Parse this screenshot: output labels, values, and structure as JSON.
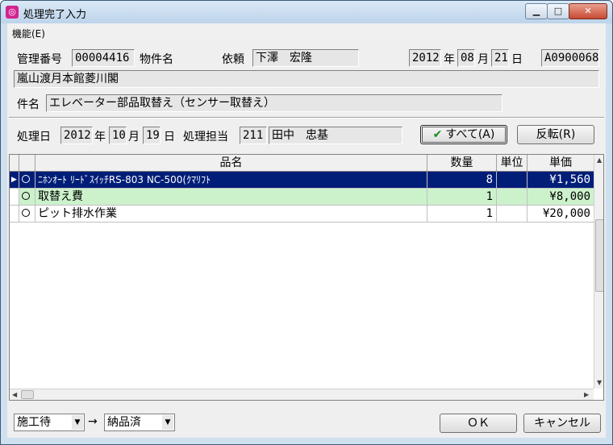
{
  "window": {
    "title": "処理完了入力",
    "icon": "app-icon"
  },
  "menu": {
    "items": [
      "機能(E)"
    ]
  },
  "header": {
    "mgmt_label": "管理番号",
    "mgmt_value": "00004416",
    "property_label": "物件名",
    "client_label": "依頼",
    "client_value": "下澤　宏隆",
    "date_year": "2012",
    "year_unit": "年",
    "date_month": "08",
    "month_unit": "月",
    "date_day": "21",
    "day_unit": "日",
    "code_value": "A0900068",
    "address": "嵐山渡月本館菱川閣",
    "subject_label": "件名",
    "subject_value": "エレベーター部品取替え（センサー取替え）"
  },
  "process": {
    "date_label": "処理日",
    "year": "2012",
    "year_unit": "年",
    "month": "10",
    "month_unit": "月",
    "day": "19",
    "day_unit": "日",
    "staff_label": "処理担当",
    "staff_code": "211",
    "staff_name": "田中　忠基",
    "all_button": "すべて(A)",
    "invert_button": "反転(R)"
  },
  "grid": {
    "columns": [
      "品名",
      "数量",
      "単位",
      "単価"
    ],
    "rows": [
      {
        "name": "ﾆﾎﾝｵｰﾄ ﾘｰﾄﾞｽｲｯﾁRS-803 NC-500(ｸﾏﾘﾌﾄ",
        "qty": "8",
        "unit": "",
        "price": "¥1,560",
        "state": "selected"
      },
      {
        "name": "取替え費",
        "qty": "1",
        "unit": "",
        "price": "¥8,000",
        "state": "highlight"
      },
      {
        "name": "ピット排水作業",
        "qty": "1",
        "unit": "",
        "price": "¥20,000",
        "state": "normal"
      }
    ]
  },
  "footer": {
    "from_status": "施工待",
    "arrow": "→",
    "to_status": "納品済",
    "ok_button": "ＯＫ",
    "cancel_button": "キャンセル"
  },
  "colors": {
    "selected_row": "#001e78",
    "highlight_row": "#ccf2cc",
    "check": "#1b8a1b"
  }
}
